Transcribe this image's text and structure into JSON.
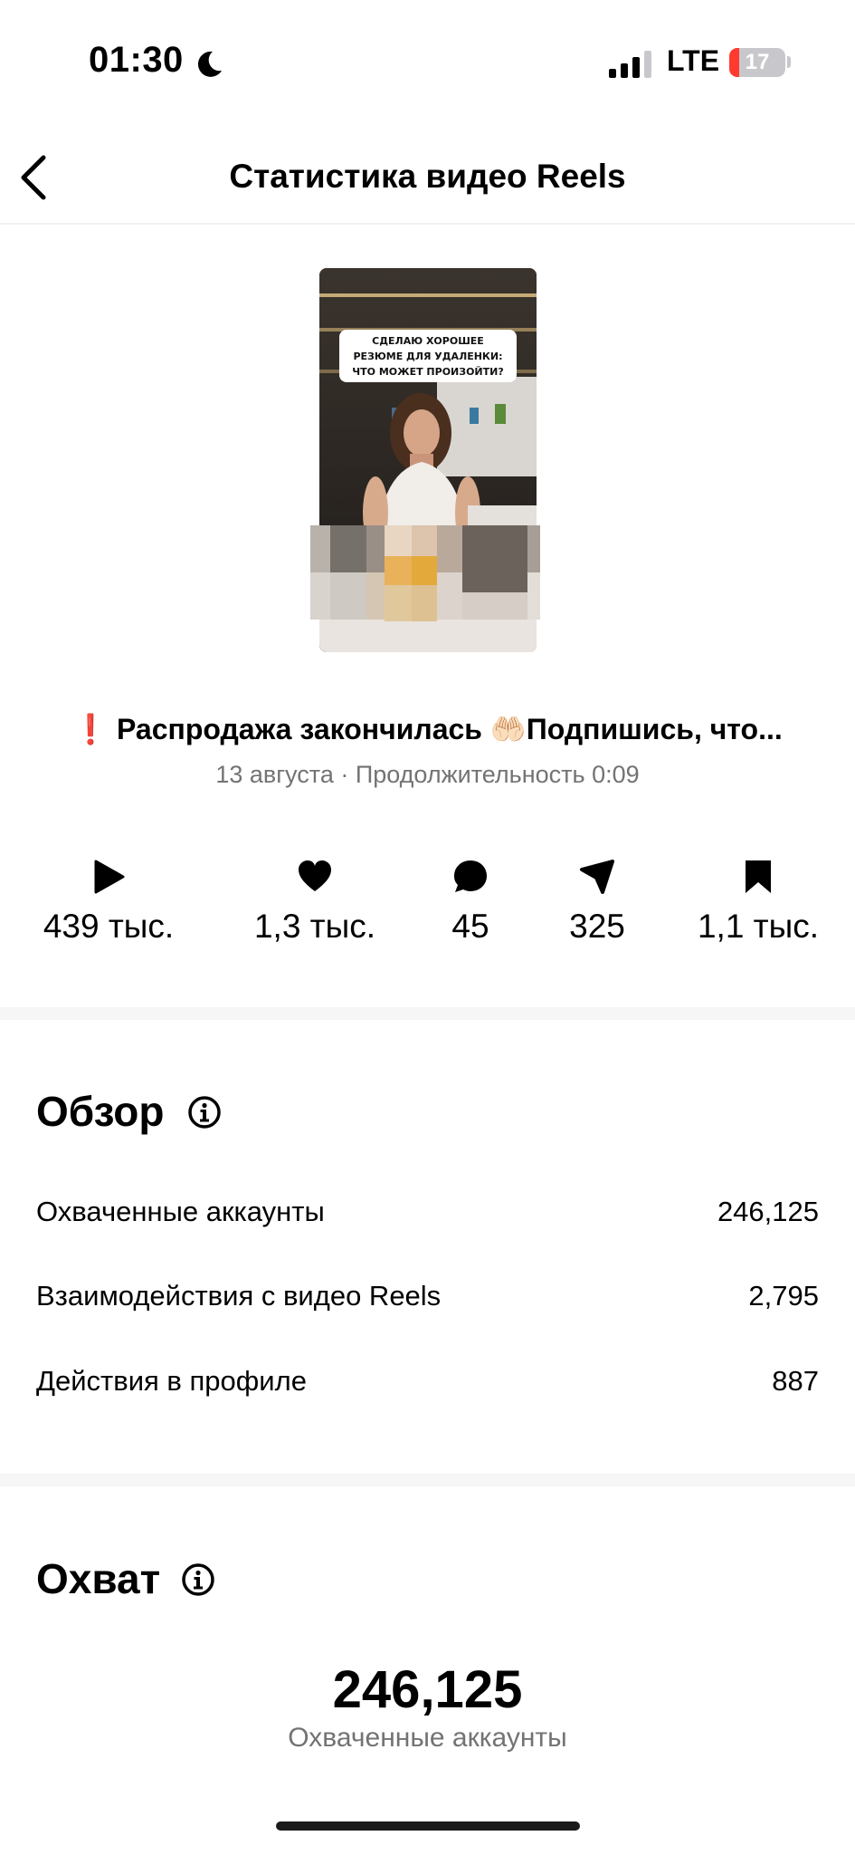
{
  "status_bar": {
    "time": "01:30",
    "network": "LTE",
    "battery": "17",
    "battery_fraction": 0.17,
    "battery_color": "#ff3b30"
  },
  "header": {
    "title": "Статистика видео Reels"
  },
  "thumbnail": {
    "overlay_lines": [
      "СДЕЛАЮ ХОРОШЕЕ",
      "РЕЗЮМЕ ДЛЯ УДАЛЕНКИ:",
      "ЧТО МОЖЕТ ПРОИЗОЙТИ?"
    ]
  },
  "post": {
    "caption": "❗ Распродажа закончилась 🤲🏻Подпишись, что...",
    "meta": "13 августа · Продолжительность 0:09"
  },
  "stats": [
    {
      "icon": "play-icon",
      "value": "439 тыс."
    },
    {
      "icon": "heart-icon",
      "value": "1,3 тыс."
    },
    {
      "icon": "comment-icon",
      "value": "45"
    },
    {
      "icon": "share-icon",
      "value": "325"
    },
    {
      "icon": "bookmark-icon",
      "value": "1,1 тыс."
    }
  ],
  "overview": {
    "title": "Обзор",
    "rows": [
      {
        "label": "Охваченные аккаунты",
        "value": "246,125"
      },
      {
        "label": "Взаимодействия с видео Reels",
        "value": "2,795"
      },
      {
        "label": "Действия в профиле",
        "value": "887"
      }
    ]
  },
  "reach": {
    "title": "Охват",
    "value": "246,125",
    "label": "Охваченные аккаунты"
  }
}
